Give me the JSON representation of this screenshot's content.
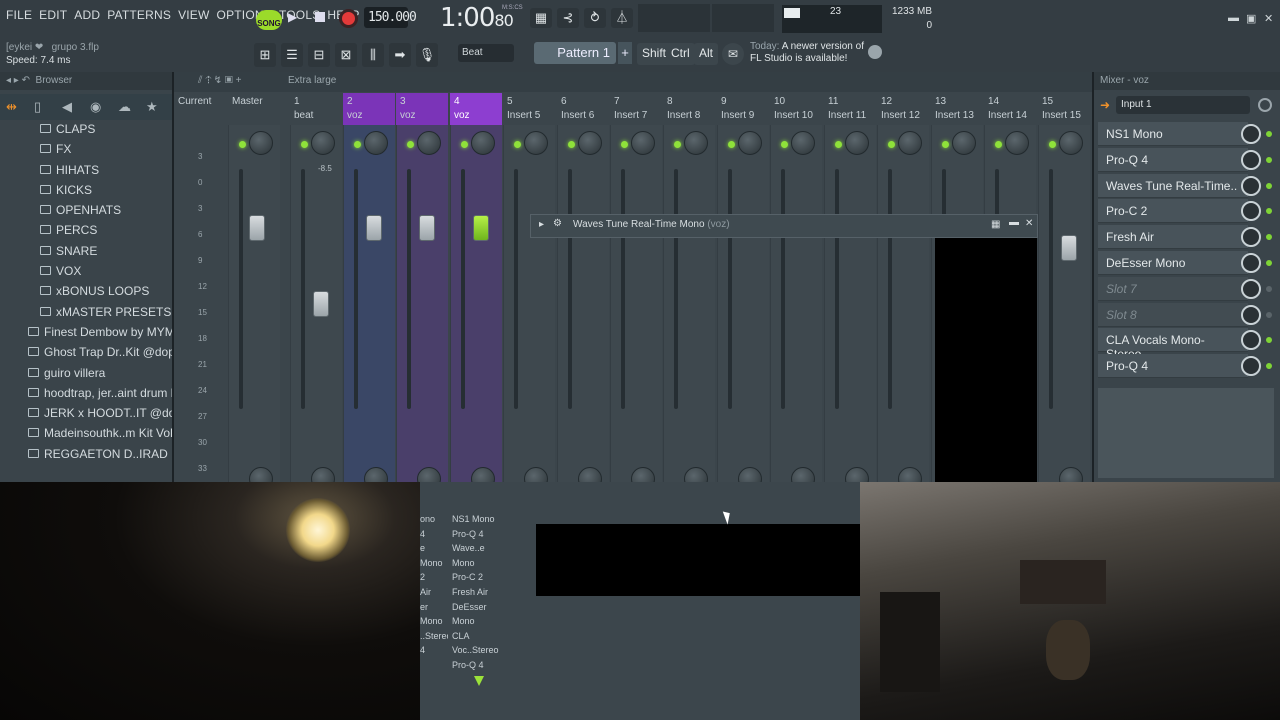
{
  "menu": [
    "FILE",
    "EDIT",
    "ADD",
    "PATTERNS",
    "VIEW",
    "OPTIONS",
    "TOOLS",
    "HELP"
  ],
  "transport": {
    "song_label": "SONG",
    "tempo": "150.000",
    "time": "1:00",
    "time_ticks": "80",
    "time_unit": "M:S:CS"
  },
  "stats": {
    "meter_value": "23",
    "memory": "1233 MB",
    "voices": "0"
  },
  "hint": {
    "project": "grupo 3.flp",
    "user": "[eykei",
    "speed": "Speed: 7.4 ms"
  },
  "toolbar": {
    "beat_label": "Beat",
    "pattern": "Pattern 1",
    "keys": [
      "Shift",
      "Ctrl",
      "Alt"
    ]
  },
  "news": {
    "prefix": "Today:",
    "text": "A newer version of FL Studio is available!"
  },
  "browser": {
    "title": "Browser",
    "items": [
      {
        "label": "CLAPS",
        "indent": 1
      },
      {
        "label": "FX",
        "indent": 1
      },
      {
        "label": "HIHATS",
        "indent": 1
      },
      {
        "label": "KICKS",
        "indent": 1
      },
      {
        "label": "OPENHATS",
        "indent": 1
      },
      {
        "label": "PERCS",
        "indent": 1
      },
      {
        "label": "SNARE",
        "indent": 1
      },
      {
        "label": "VOX",
        "indent": 1
      },
      {
        "label": "xBONUS LOOPS",
        "indent": 1
      },
      {
        "label": "xMASTER PRESETS",
        "indent": 1
      },
      {
        "label": "Finest Dembow by MYMBA",
        "indent": 0
      },
      {
        "label": "Ghost Trap Dr..Kit @dopekit",
        "indent": 0
      },
      {
        "label": "guiro villera",
        "indent": 0
      },
      {
        "label": "hoodtrap, jer..aint drum kit",
        "indent": 0
      },
      {
        "label": "JERK x HOODT..IT @dopekit",
        "indent": 0
      },
      {
        "label": "Madeinsouthk..m Kit Vol. 2",
        "indent": 0
      },
      {
        "label": "REGGAETON D..IRAD BEATS",
        "indent": 0
      }
    ]
  },
  "mixer": {
    "view": "Extra large",
    "channels": [
      {
        "num": "",
        "name": "Current"
      },
      {
        "num": "",
        "name": "Master"
      },
      {
        "num": "1",
        "name": "beat"
      },
      {
        "num": "2",
        "name": "voz"
      },
      {
        "num": "3",
        "name": "voz"
      },
      {
        "num": "4",
        "name": "voz"
      },
      {
        "num": "5",
        "name": "Insert 5"
      },
      {
        "num": "6",
        "name": "Insert 6"
      },
      {
        "num": "7",
        "name": "Insert 7"
      },
      {
        "num": "8",
        "name": "Insert 8"
      },
      {
        "num": "9",
        "name": "Insert 9"
      },
      {
        "num": "10",
        "name": "Insert 10"
      },
      {
        "num": "11",
        "name": "Insert 11"
      },
      {
        "num": "12",
        "name": "Insert 12"
      },
      {
        "num": "13",
        "name": "Insert 13"
      },
      {
        "num": "14",
        "name": "Insert 14"
      },
      {
        "num": "15",
        "name": "Insert 15"
      }
    ],
    "scale": [
      "3",
      "0",
      "3",
      "6",
      "9",
      "12",
      "15",
      "18",
      "21",
      "24",
      "27",
      "30",
      "33"
    ],
    "beat_db": "-8.5"
  },
  "plugin_window": {
    "title": "Waves Tune Real-Time Mono",
    "suffix": "(voz)"
  },
  "fx_panel": {
    "title": "Mixer - voz",
    "input": "Input 1",
    "slots": [
      {
        "label": "NS1 Mono",
        "empty": false
      },
      {
        "label": "Pro-Q 4",
        "empty": false
      },
      {
        "label": "Waves Tune Real-Time..",
        "empty": false
      },
      {
        "label": "Pro-C 2",
        "empty": false
      },
      {
        "label": "Fresh Air",
        "empty": false
      },
      {
        "label": "DeEsser Mono",
        "empty": false
      },
      {
        "label": "Slot 7",
        "empty": true
      },
      {
        "label": "Slot 8",
        "empty": true
      },
      {
        "label": "CLA Vocals Mono-Stereo",
        "empty": false
      },
      {
        "label": "Pro-Q 4",
        "empty": false
      }
    ]
  },
  "strip_labels_a": [
    "ono",
    "4",
    "e Mono",
    "2",
    "Air",
    "er Mono",
    "..Stereo",
    "4"
  ],
  "strip_labels_b": [
    "NS1 Mono",
    "Pro-Q 4",
    "Wave..e Mono",
    "Pro-C 2",
    "Fresh Air",
    "DeEsser Mono",
    "CLA Voc..Stereo",
    "Pro-Q 4"
  ]
}
